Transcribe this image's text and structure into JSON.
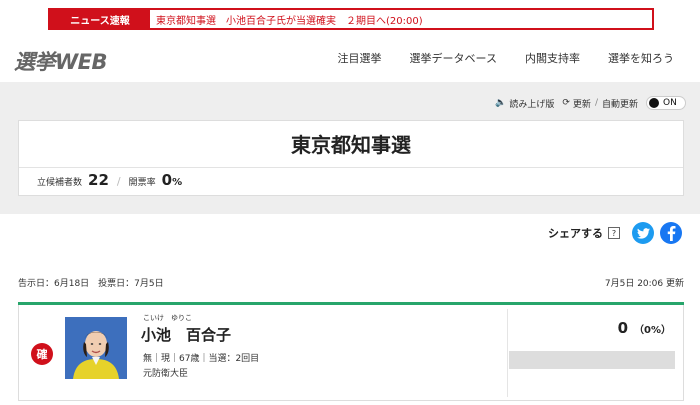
{
  "news": {
    "label": "ニュース速報",
    "text": "東京都知事選　小池百合子氏が当選確実　２期目へ(20:00)"
  },
  "header": {
    "logo": "選挙WEB",
    "nav": [
      "注目選挙",
      "選挙データベース",
      "内閣支持率",
      "選挙を知ろう"
    ]
  },
  "tools": {
    "read_aloud": "読み上げ版",
    "update": "更新",
    "auto_update": "自動更新",
    "toggle_state": "ON"
  },
  "election": {
    "title": "東京都知事選",
    "candidates_label": "立候補者数",
    "candidates_count": "22",
    "turnout_label": "開票率",
    "turnout_value": "0",
    "turnout_unit": "%"
  },
  "share": {
    "label": "シェアする",
    "help": "?"
  },
  "dates": {
    "announcement": "告示日：6月18日　投票日：7月5日",
    "updated": "7月5日 20:06 更新"
  },
  "candidate": {
    "badge": "確",
    "ruby": "こいけ　ゆりこ",
    "name": "小池　百合子",
    "meta": "無｜現｜67歳｜当選：2回目",
    "role": "元防衛大臣",
    "votes": "0",
    "vote_pct": "（0%）",
    "vote_fraction": 0
  },
  "colors": {
    "accent_red": "#d0101b",
    "green_line": "#27a56b",
    "twitter": "#1d9bf0",
    "facebook": "#1877f2"
  }
}
